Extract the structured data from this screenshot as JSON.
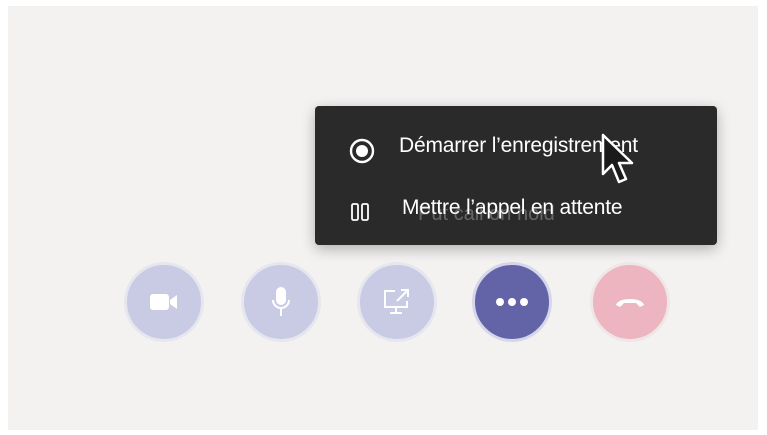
{
  "menu": {
    "start_recording": "Démarrer l’enregistrement",
    "hold_call": "Mettre l’appel en attente",
    "ghost_text": "Put call on hold"
  },
  "controls": {
    "video": "video-camera-icon",
    "mic": "microphone-icon",
    "share": "share-screen-icon",
    "more": "more-options-icon",
    "hangup": "hang-up-icon"
  },
  "colors": {
    "background": "#f3f2f1",
    "menu_bg": "#2b2a2a",
    "control_idle": "#c9cbe4",
    "control_active": "#6264a7",
    "hangup": "#ecb5bf"
  }
}
